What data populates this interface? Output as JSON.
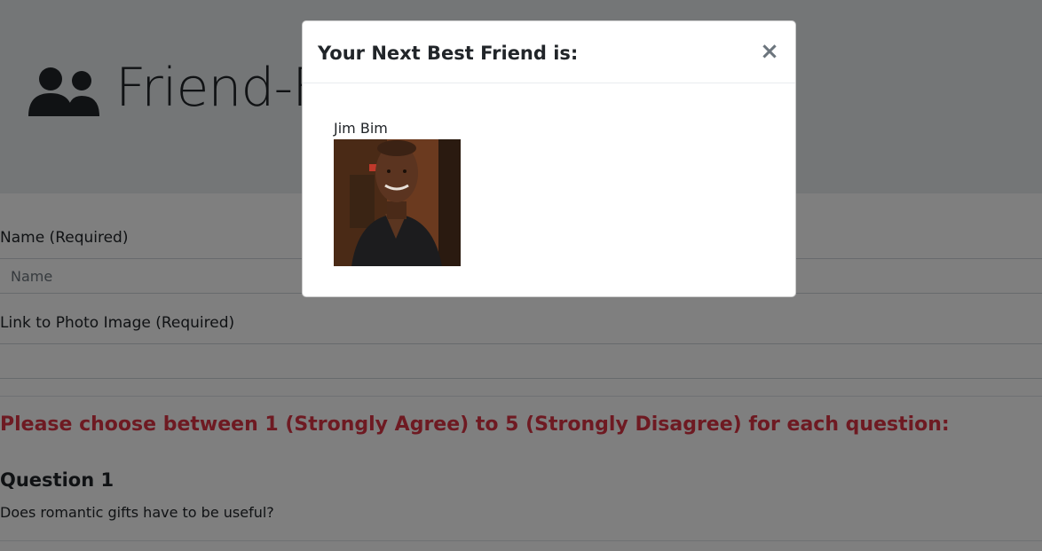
{
  "page": {
    "brand_title": "Friend-Finder",
    "brand_icon": "users-icon"
  },
  "form": {
    "name_label": "Name (Required)",
    "name_placeholder": "Name",
    "name_value": "",
    "photo_label": "Link to Photo Image (Required)",
    "photo_placeholder": "",
    "photo_value": "",
    "instructions": "Please choose between 1 (Strongly Agree) to 5 (Strongly Disagree) for each question:",
    "questions": [
      {
        "title": "Question 1",
        "text": "Does romantic gifts have to be useful?"
      }
    ]
  },
  "modal": {
    "title": "Your Next Best Friend is:",
    "close_label": "×",
    "friend_name": "Jim Bim",
    "friend_photo_icon": "person-photo"
  },
  "colors": {
    "instructions": "#dc3545",
    "jumbotron_bg": "#e9ecef",
    "backdrop": "rgba(0,0,0,0.5)"
  }
}
